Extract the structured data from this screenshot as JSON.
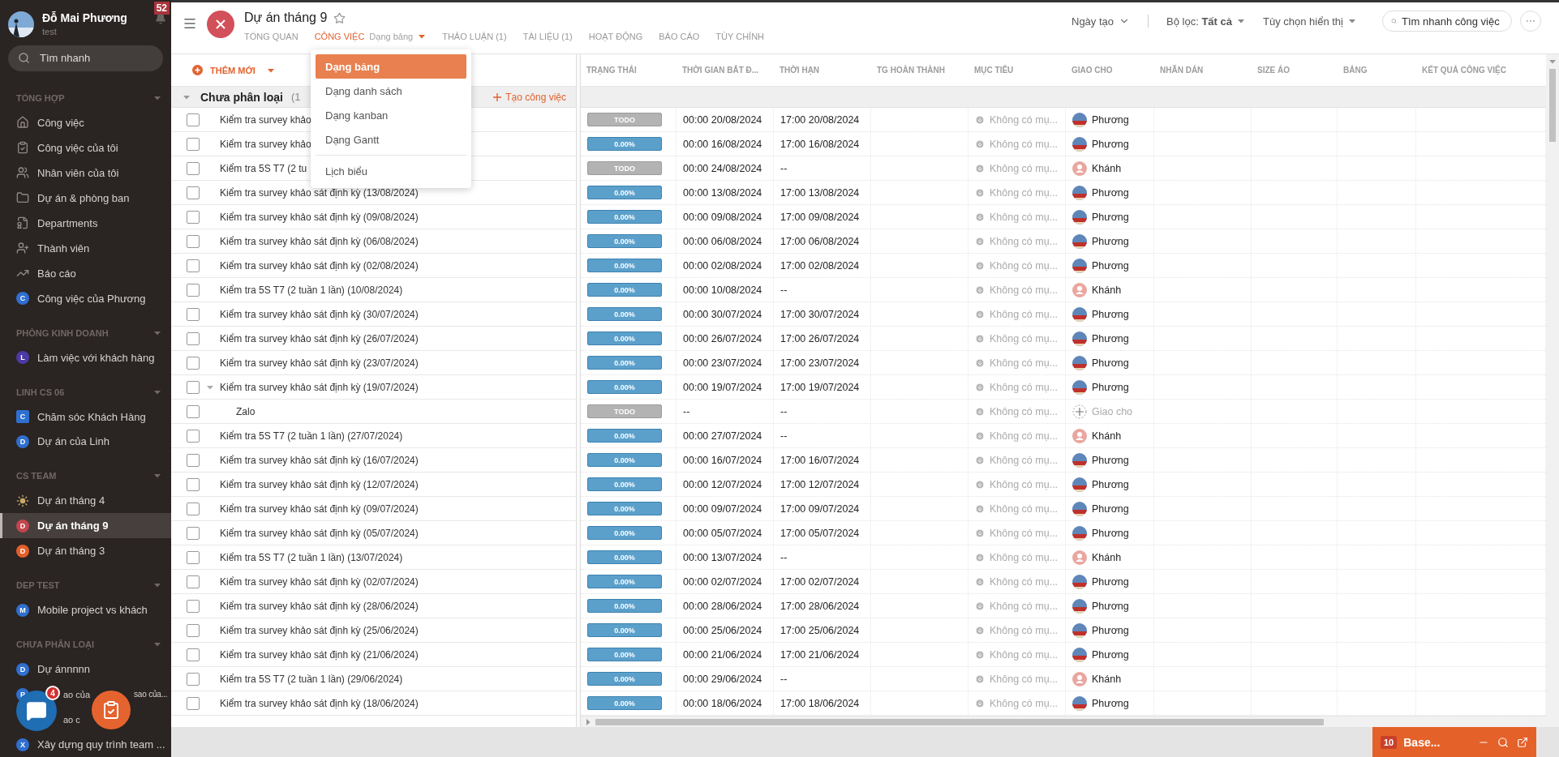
{
  "sidebar": {
    "user": {
      "name": "Đỗ Mai Phương",
      "subtitle": "test"
    },
    "notifications": "52",
    "search": {
      "placeholder": "Tìm nhanh"
    },
    "sections": [
      {
        "title": "TỔNG HỢP",
        "items": [
          {
            "kind": "home",
            "label": "Công việc",
            "selected": false
          },
          {
            "kind": "clipboard",
            "label": "Công việc của tôi",
            "selected": false
          },
          {
            "kind": "people",
            "label": "Nhân viên của tôi",
            "selected": false
          },
          {
            "kind": "folder",
            "label": "Dự án & phòng ban",
            "selected": false
          },
          {
            "kind": "document",
            "label": "Departments",
            "selected": false
          },
          {
            "kind": "member",
            "label": "Thành viên",
            "selected": false
          },
          {
            "kind": "chart",
            "label": "Báo cáo",
            "selected": false
          },
          {
            "kind": "letter",
            "letter": "C",
            "color": "#2f6fcf",
            "label": "Công việc của Phương",
            "selected": false
          }
        ]
      },
      {
        "title": "PHÒNG KINH DOANH",
        "items": [
          {
            "kind": "letter",
            "letter": "L",
            "color": "#4b3aa6",
            "label": "Làm việc với khách hàng",
            "selected": false
          }
        ]
      },
      {
        "title": "LINH CS 06",
        "items": [
          {
            "kind": "square",
            "letter": "C",
            "color": "#2f6fcf",
            "label": "Chăm sóc Khách Hàng",
            "selected": false
          },
          {
            "kind": "letter",
            "letter": "D",
            "color": "#2f6fcf",
            "label": "Dự án của Linh",
            "selected": false
          }
        ]
      },
      {
        "title": "CS TEAM",
        "items": [
          {
            "kind": "sun",
            "label": "Dự án tháng 4",
            "selected": false
          },
          {
            "kind": "letter",
            "letter": "D",
            "color": "#c4454d",
            "label": "Dự án tháng 9",
            "selected": true
          },
          {
            "kind": "letter",
            "letter": "D",
            "color": "#e45e2b",
            "label": "Dự án tháng 3",
            "selected": false
          }
        ]
      },
      {
        "title": "DEP TEST",
        "items": [
          {
            "kind": "letter",
            "letter": "M",
            "color": "#2f6fcf",
            "label": "Mobile project vs khách",
            "selected": false
          }
        ]
      },
      {
        "title": "CHƯA PHÂN LOẠI",
        "items": [
          {
            "kind": "letter",
            "letter": "D",
            "color": "#2f6fcf",
            "label": "Dự ánnnnn",
            "selected": false
          },
          {
            "kind": "letter",
            "letter": "P",
            "color": "#2f6fcf",
            "label": "ao của",
            "label_end": "sao của...",
            "covered": true,
            "selected": false
          },
          {
            "kind": "covered",
            "label": "ao c",
            "covered": true,
            "selected": false
          },
          {
            "kind": "letter",
            "letter": "X",
            "color": "#2f6fcf",
            "label": "Xây dựng quy trình team ...",
            "selected": false
          }
        ]
      }
    ]
  },
  "floating_buttons": {
    "chat_badge": "4"
  },
  "header": {
    "title": "Dự án tháng 9",
    "tabs": [
      {
        "label": "TỔNG QUAN",
        "selected": false
      },
      {
        "label": "CÔNG VIỆC",
        "selected": true,
        "view": "Dạng bảng"
      },
      {
        "label": "THẢO LUẬN (1)",
        "selected": false
      },
      {
        "label": "TÀI LIỆU (1)",
        "selected": false
      },
      {
        "label": "HOẠT ĐỘNG",
        "selected": false
      },
      {
        "label": "BÁO CÁO",
        "selected": false
      },
      {
        "label": "TÙY CHỈNH",
        "selected": false
      }
    ],
    "sort": "Ngày tạo",
    "filter": "Bộ lọc: **Tất cả**",
    "display_options": "Tùy chọn hiển thị",
    "search": {
      "placeholder": "Tìm nhanh công việc"
    }
  },
  "view_menu": {
    "items": [
      {
        "label": "Dạng bảng",
        "selected": true
      },
      {
        "label": "Dạng danh sách",
        "selected": false
      },
      {
        "label": "Dạng kanban",
        "selected": false
      },
      {
        "label": "Dạng Gantt",
        "selected": false
      }
    ],
    "extra_items": [
      {
        "label": "Lịch biểu",
        "selected": false
      }
    ]
  },
  "toolbar": {
    "add_button": "THÊM MỚI"
  },
  "group": {
    "title": "Chưa phân loại",
    "count": "(1",
    "expanded": true,
    "create_button": "Tạo công việc"
  },
  "table": {
    "columns": [
      "TRẠNG THÁI",
      "THỜI GIAN BẮT Đ...",
      "THỜI HẠN",
      "TG HOÀN THÀNH",
      "MỤC TIÊU",
      "GIAO CHO",
      "NHÃN DÁN",
      "SIZE ÁO",
      "BẢNG",
      "KẾT QUẢ CÔNG VIỆC"
    ],
    "rows": [
      {
        "title": "Kiểm tra survey khảo",
        "checked": false,
        "status": {
          "kind": "todo",
          "label": "TODO"
        },
        "start": "00:00 20/08/2024",
        "due": "17:00 20/08/2024",
        "goal": "Không có mụ...",
        "assignee": {
          "kind": "photo",
          "name": "Phương"
        }
      },
      {
        "title": "Kiểm tra survey khảo",
        "checked": false,
        "status": {
          "kind": "progress",
          "label": "0.00%"
        },
        "start": "00:00 16/08/2024",
        "due": "17:00 16/08/2024",
        "goal": "Không có mụ...",
        "assignee": {
          "kind": "photo",
          "name": "Phương"
        }
      },
      {
        "title": "Kiểm tra 5S T7 (2 tu",
        "checked": false,
        "status": {
          "kind": "todo",
          "label": "TODO"
        },
        "start": "00:00 24/08/2024",
        "due": "--",
        "goal": "Không có mụ...",
        "assignee": {
          "kind": "person",
          "name": "Khánh"
        }
      },
      {
        "title": "Kiểm tra survey khảo sát định kỳ (13/08/2024)",
        "checked": false,
        "status": {
          "kind": "progress",
          "label": "0.00%"
        },
        "start": "00:00 13/08/2024",
        "due": "17:00 13/08/2024",
        "goal": "Không có mụ...",
        "assignee": {
          "kind": "photo",
          "name": "Phương"
        }
      },
      {
        "title": "Kiểm tra survey khảo sát định kỳ (09/08/2024)",
        "checked": false,
        "status": {
          "kind": "progress",
          "label": "0.00%"
        },
        "start": "00:00 09/08/2024",
        "due": "17:00 09/08/2024",
        "goal": "Không có mụ...",
        "assignee": {
          "kind": "photo",
          "name": "Phương"
        }
      },
      {
        "title": "Kiểm tra survey khảo sát định kỳ (06/08/2024)",
        "checked": false,
        "status": {
          "kind": "progress",
          "label": "0.00%"
        },
        "start": "00:00 06/08/2024",
        "due": "17:00 06/08/2024",
        "goal": "Không có mụ...",
        "assignee": {
          "kind": "photo",
          "name": "Phương"
        }
      },
      {
        "title": "Kiểm tra survey khảo sát định kỳ (02/08/2024)",
        "checked": false,
        "status": {
          "kind": "progress",
          "label": "0.00%"
        },
        "start": "00:00 02/08/2024",
        "due": "17:00 02/08/2024",
        "goal": "Không có mụ...",
        "assignee": {
          "kind": "photo",
          "name": "Phương"
        }
      },
      {
        "title": "Kiểm tra 5S T7 (2 tuần 1 lần) (10/08/2024)",
        "checked": false,
        "status": {
          "kind": "progress",
          "label": "0.00%"
        },
        "start": "00:00 10/08/2024",
        "due": "--",
        "goal": "Không có mụ...",
        "assignee": {
          "kind": "person",
          "name": "Khánh"
        }
      },
      {
        "title": "Kiểm tra survey khảo sát định kỳ (30/07/2024)",
        "checked": false,
        "status": {
          "kind": "progress",
          "label": "0.00%"
        },
        "start": "00:00 30/07/2024",
        "due": "17:00 30/07/2024",
        "goal": "Không có mụ...",
        "assignee": {
          "kind": "photo",
          "name": "Phương"
        }
      },
      {
        "title": "Kiểm tra survey khảo sát định kỳ (26/07/2024)",
        "checked": false,
        "status": {
          "kind": "progress",
          "label": "0.00%"
        },
        "start": "00:00 26/07/2024",
        "due": "17:00 26/07/2024",
        "goal": "Không có mụ...",
        "assignee": {
          "kind": "photo",
          "name": "Phương"
        }
      },
      {
        "title": "Kiểm tra survey khảo sát định kỳ (23/07/2024)",
        "checked": false,
        "status": {
          "kind": "progress",
          "label": "0.00%"
        },
        "start": "00:00 23/07/2024",
        "due": "17:00 23/07/2024",
        "goal": "Không có mụ...",
        "assignee": {
          "kind": "photo",
          "name": "Phương"
        }
      },
      {
        "title": "Kiểm tra survey khảo sát định kỳ (19/07/2024)",
        "checked": false,
        "status": {
          "kind": "progress",
          "label": "0.00%"
        },
        "start": "00:00 19/07/2024",
        "due": "17:00 19/07/2024",
        "goal": "Không có mụ...",
        "assignee": {
          "kind": "photo",
          "name": "Phương"
        },
        "expanded": true,
        "children": [
          {
            "title": "Zalo",
            "checked": false,
            "status": {
              "kind": "todo",
              "label": "TODO"
            },
            "start": "--",
            "due": "--",
            "goal": "Không có mụ...",
            "assignee": {
              "kind": "empty",
              "name": "Giao cho"
            }
          }
        ]
      },
      {
        "title": "Kiểm tra 5S T7 (2 tuần 1 lần) (27/07/2024)",
        "checked": false,
        "status": {
          "kind": "progress",
          "label": "0.00%"
        },
        "start": "00:00 27/07/2024",
        "due": "--",
        "goal": "Không có mụ...",
        "assignee": {
          "kind": "person",
          "name": "Khánh"
        }
      },
      {
        "title": "Kiểm tra survey khảo sát định kỳ (16/07/2024)",
        "checked": false,
        "status": {
          "kind": "progress",
          "label": "0.00%"
        },
        "start": "00:00 16/07/2024",
        "due": "17:00 16/07/2024",
        "goal": "Không có mụ...",
        "assignee": {
          "kind": "photo",
          "name": "Phương"
        }
      },
      {
        "title": "Kiểm tra survey khảo sát định kỳ (12/07/2024)",
        "checked": false,
        "status": {
          "kind": "progress",
          "label": "0.00%"
        },
        "start": "00:00 12/07/2024",
        "due": "17:00 12/07/2024",
        "goal": "Không có mụ...",
        "assignee": {
          "kind": "photo",
          "name": "Phương"
        }
      },
      {
        "title": "Kiểm tra survey khảo sát định kỳ (09/07/2024)",
        "checked": false,
        "status": {
          "kind": "progress",
          "label": "0.00%"
        },
        "start": "00:00 09/07/2024",
        "due": "17:00 09/07/2024",
        "goal": "Không có mụ...",
        "assignee": {
          "kind": "photo",
          "name": "Phương"
        }
      },
      {
        "title": "Kiểm tra survey khảo sát định kỳ (05/07/2024)",
        "checked": false,
        "status": {
          "kind": "progress",
          "label": "0.00%"
        },
        "start": "00:00 05/07/2024",
        "due": "17:00 05/07/2024",
        "goal": "Không có mụ...",
        "assignee": {
          "kind": "photo",
          "name": "Phương"
        }
      },
      {
        "title": "Kiểm tra 5S T7 (2 tuần 1 lần) (13/07/2024)",
        "checked": false,
        "status": {
          "kind": "progress",
          "label": "0.00%"
        },
        "start": "00:00 13/07/2024",
        "due": "--",
        "goal": "Không có mụ...",
        "assignee": {
          "kind": "person",
          "name": "Khánh"
        }
      },
      {
        "title": "Kiểm tra survey khảo sát định kỳ (02/07/2024)",
        "checked": false,
        "status": {
          "kind": "progress",
          "label": "0.00%"
        },
        "start": "00:00 02/07/2024",
        "due": "17:00 02/07/2024",
        "goal": "Không có mụ...",
        "assignee": {
          "kind": "photo",
          "name": "Phương"
        }
      },
      {
        "title": "Kiểm tra survey khảo sát định kỳ (28/06/2024)",
        "checked": false,
        "status": {
          "kind": "progress",
          "label": "0.00%"
        },
        "start": "00:00 28/06/2024",
        "due": "17:00 28/06/2024",
        "goal": "Không có mụ...",
        "assignee": {
          "kind": "photo",
          "name": "Phương"
        }
      },
      {
        "title": "Kiểm tra survey khảo sát định kỳ (25/06/2024)",
        "checked": false,
        "status": {
          "kind": "progress",
          "label": "0.00%"
        },
        "start": "00:00 25/06/2024",
        "due": "17:00 25/06/2024",
        "goal": "Không có mụ...",
        "assignee": {
          "kind": "photo",
          "name": "Phương"
        }
      },
      {
        "title": "Kiểm tra survey khảo sát định kỳ (21/06/2024)",
        "checked": false,
        "status": {
          "kind": "progress",
          "label": "0.00%"
        },
        "start": "00:00 21/06/2024",
        "due": "17:00 21/06/2024",
        "goal": "Không có mụ...",
        "assignee": {
          "kind": "photo",
          "name": "Phương"
        }
      },
      {
        "title": "Kiểm tra 5S T7 (2 tuần 1 lần) (29/06/2024)",
        "checked": false,
        "status": {
          "kind": "progress",
          "label": "0.00%"
        },
        "start": "00:00 29/06/2024",
        "due": "--",
        "goal": "Không có mụ...",
        "assignee": {
          "kind": "person",
          "name": "Khánh"
        }
      },
      {
        "title": "Kiểm tra survey khảo sát định kỳ (18/06/2024)",
        "checked": false,
        "status": {
          "kind": "progress",
          "label": "0.00%"
        },
        "start": "00:00 18/06/2024",
        "due": "17:00 18/06/2024",
        "goal": "Không có mụ...",
        "assignee": {
          "kind": "photo",
          "name": "Phương"
        }
      }
    ]
  },
  "base_panel": {
    "count": "10",
    "title": "Base..."
  }
}
